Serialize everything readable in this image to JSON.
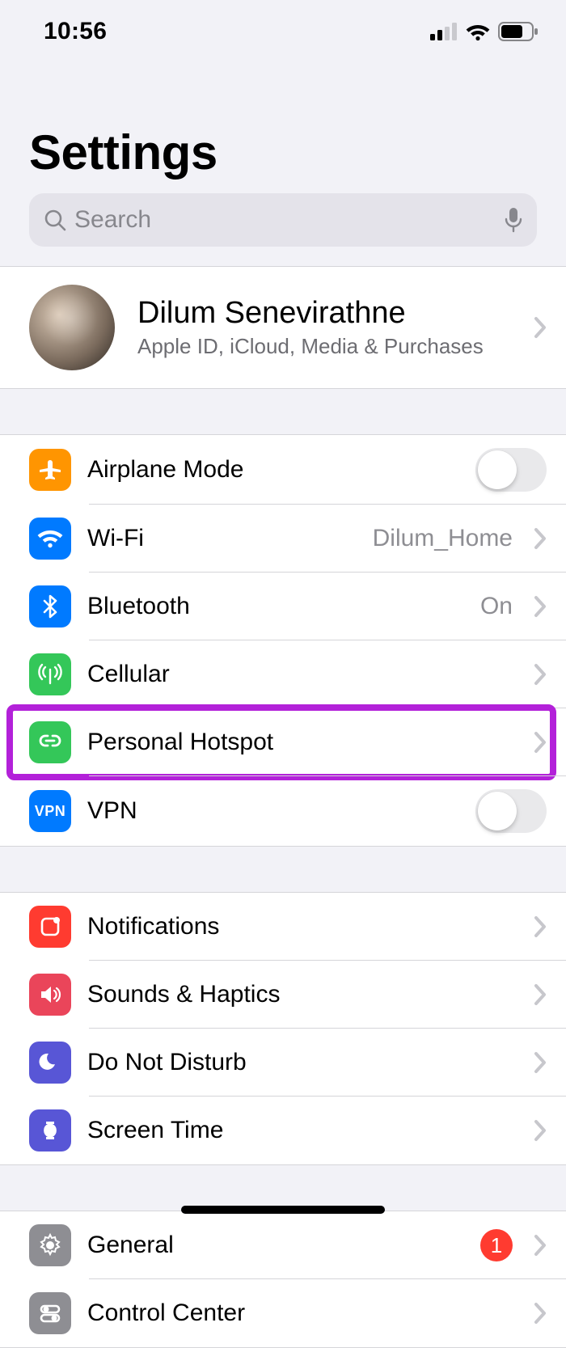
{
  "status": {
    "time": "10:56"
  },
  "header": {
    "title": "Settings"
  },
  "search": {
    "placeholder": "Search"
  },
  "profile": {
    "name": "Dilum Senevirathne",
    "subtitle": "Apple ID, iCloud, Media & Purchases"
  },
  "groups": [
    {
      "rows": [
        {
          "id": "airplane-mode",
          "label": "Airplane Mode",
          "accessory": "toggle",
          "color": "#ff9501"
        },
        {
          "id": "wifi",
          "label": "Wi-Fi",
          "detail": "Dilum_Home",
          "accessory": "chevron",
          "color": "#007aff"
        },
        {
          "id": "bluetooth",
          "label": "Bluetooth",
          "detail": "On",
          "accessory": "chevron",
          "color": "#007aff"
        },
        {
          "id": "cellular",
          "label": "Cellular",
          "accessory": "chevron",
          "color": "#34c759"
        },
        {
          "id": "personal-hotspot",
          "label": "Personal Hotspot",
          "accessory": "chevron",
          "color": "#34c759",
          "highlighted": true
        },
        {
          "id": "vpn",
          "label": "VPN",
          "accessory": "toggle",
          "color": "#007aff",
          "iconText": "VPN"
        }
      ]
    },
    {
      "rows": [
        {
          "id": "notifications",
          "label": "Notifications",
          "accessory": "chevron",
          "color": "#ff3b30"
        },
        {
          "id": "sounds",
          "label": "Sounds & Haptics",
          "accessory": "chevron",
          "color": "#ea455a"
        },
        {
          "id": "do-not-disturb",
          "label": "Do Not Disturb",
          "accessory": "chevron",
          "color": "#5856d6"
        },
        {
          "id": "screen-time",
          "label": "Screen Time",
          "accessory": "chevron",
          "color": "#5856d6"
        }
      ]
    },
    {
      "rows": [
        {
          "id": "general",
          "label": "General",
          "accessory": "chevron",
          "color": "#8e8e93",
          "badge": "1"
        },
        {
          "id": "control-center",
          "label": "Control Center",
          "accessory": "chevron",
          "color": "#8e8e93"
        }
      ]
    }
  ]
}
